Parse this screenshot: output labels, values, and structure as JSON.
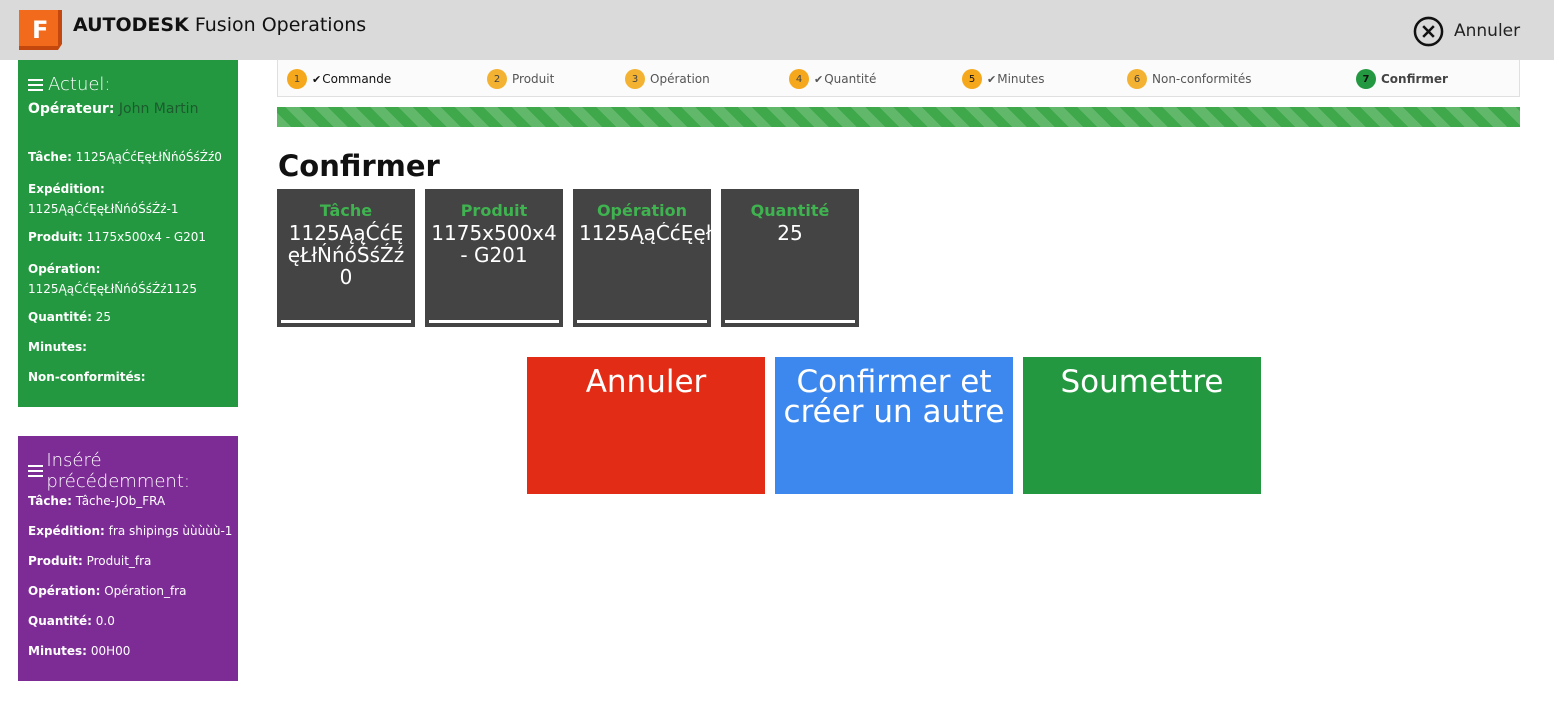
{
  "header": {
    "logo_letter": "F",
    "brand_bold": "AUTODESK",
    "brand_rest": "Fusion Operations",
    "cancel_label": "Annuler",
    "cancel_icon": "close-circle-icon"
  },
  "current": {
    "title": "Actuel:",
    "operator_label": "Opérateur",
    "operator_value": "John Martin",
    "fields": [
      {
        "label": "Tâche",
        "value": "1125ĄąĆćĘęŁłŃńóŚśŹź0"
      },
      {
        "label": "Expédition",
        "value": "1125ĄąĆćĘęŁłŃńóŚśŹź-1"
      },
      {
        "label": "Produit",
        "value": "1175x500x4 - G201"
      },
      {
        "label": "Opération",
        "value": "1125ĄąĆćĘęŁłŃńóŚśŹź1125"
      },
      {
        "label": "Quantité",
        "value": "25"
      },
      {
        "label": "Minutes",
        "value": ""
      },
      {
        "label": "Non-conformités",
        "value": ""
      }
    ]
  },
  "previous": {
    "title": "Inséré précédemment:",
    "fields": [
      {
        "label": "Tâche",
        "value": "Tâche-JOb_FRA"
      },
      {
        "label": "Expédition",
        "value": "fra shipings ùùùùù-1"
      },
      {
        "label": "Produit",
        "value": "Produit_fra"
      },
      {
        "label": "Opération",
        "value": "Opération_fra"
      },
      {
        "label": "Quantité",
        "value": "0.0"
      },
      {
        "label": "Minutes",
        "value": "00H00"
      }
    ]
  },
  "steps": [
    {
      "num": "1",
      "label": "Commande",
      "checked": true
    },
    {
      "num": "2",
      "label": "Produit",
      "checked": false
    },
    {
      "num": "3",
      "label": "Opération",
      "checked": false
    },
    {
      "num": "4",
      "label": "Quantité",
      "checked": true
    },
    {
      "num": "5",
      "label": "Minutes",
      "checked": true
    },
    {
      "num": "6",
      "label": "Non-conformités",
      "checked": false
    },
    {
      "num": "7",
      "label": "Confirmer",
      "checked": false,
      "active": true
    }
  ],
  "progress_fraction": 1.0,
  "page_title": "Confirmer",
  "cards": [
    {
      "label": "Tâche",
      "value": "1125ĄąĆćĘęŁłŃńóŚśŹź0"
    },
    {
      "label": "Produit",
      "value": "1175x500x4 - G201"
    },
    {
      "label": "Opération",
      "value": "1125ĄąĆćĘęł"
    },
    {
      "label": "Quantité",
      "value": "25"
    }
  ],
  "buttons": {
    "cancel": "Annuler",
    "confirm": "Confirmer et créer un autre",
    "submit": "Soumettre"
  },
  "colors": {
    "current_panel": "#239840",
    "previous_panel": "#7d2c96",
    "cancel_button": "#e32c15",
    "confirm_button": "#3d88ee",
    "submit_button": "#239840",
    "step_badge": "#f4b232"
  }
}
